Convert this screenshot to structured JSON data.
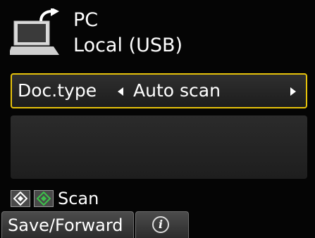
{
  "header": {
    "icon": "pc-icon",
    "destination_name": "PC",
    "connection": "Local (USB)"
  },
  "doc_type": {
    "label": "Doc.type",
    "value": "Auto scan",
    "left_arrow": "arrow-left-icon",
    "right_arrow": "arrow-right-icon"
  },
  "scan_hint": {
    "black_button_icon": "black-start-icon",
    "color_button_icon": "color-start-icon",
    "label": "Scan",
    "color_button_accent": "#3cc24a"
  },
  "tabs": {
    "save_forward_label": "Save/Forward",
    "info_glyph": "i",
    "info_icon": "info-icon"
  },
  "colors": {
    "selection_border": "#e6c20b",
    "background": "#050505"
  }
}
